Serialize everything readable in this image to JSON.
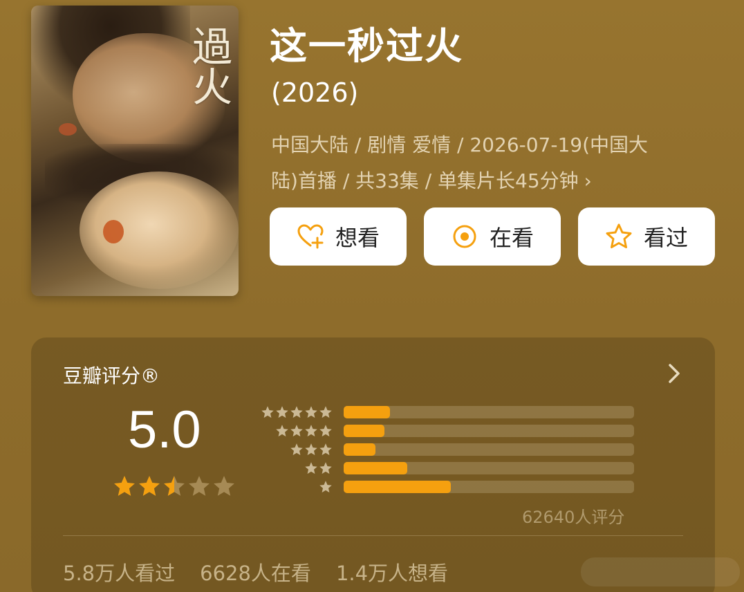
{
  "poster": {
    "calligraphy": "過火"
  },
  "header": {
    "title": "这一秒过火",
    "year": "(2026)",
    "meta_line1": "中国大陆 / 剧情 爱情 / 2026-07-19(中国大",
    "meta_line2": "陆)首播 / 共33集 / 单集片长45分钟",
    "meta_chevron": "›"
  },
  "actions": {
    "want": "想看",
    "watching": "在看",
    "watched": "看过"
  },
  "rating": {
    "title": "豆瓣评分®",
    "score": "5.0",
    "score_value": 5.0,
    "stars_filled": 2.5,
    "distribution": [
      {
        "stars": 5,
        "fraction": 0.16
      },
      {
        "stars": 4,
        "fraction": 0.14
      },
      {
        "stars": 3,
        "fraction": 0.11
      },
      {
        "stars": 2,
        "fraction": 0.22
      },
      {
        "stars": 1,
        "fraction": 0.37
      }
    ],
    "count_text": "62640人评分"
  },
  "stats": {
    "watched": "5.8万人看过",
    "watching": "6628人在看",
    "want": "1.4万人想看"
  },
  "colors": {
    "accent": "#f5a00f",
    "background": "#94712f",
    "star_empty": "#a68a55",
    "star_mini": "#cbb995"
  }
}
